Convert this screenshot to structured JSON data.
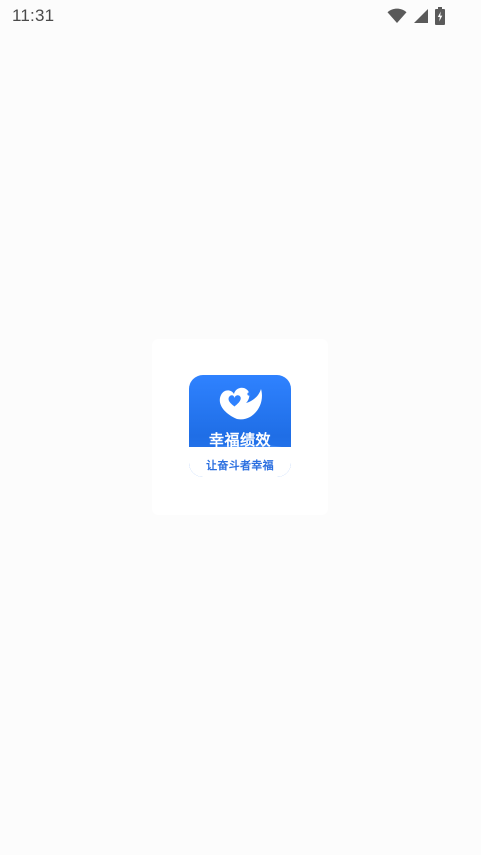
{
  "status_bar": {
    "time": "11:31",
    "icons": [
      "wifi-icon",
      "cellular-signal-icon",
      "battery-charging-icon"
    ]
  },
  "splash": {
    "app_name": "幸福绩效",
    "slogan": "让奋斗者幸福",
    "brand_color": "#2f82ff",
    "background": "#fcfcfc"
  }
}
